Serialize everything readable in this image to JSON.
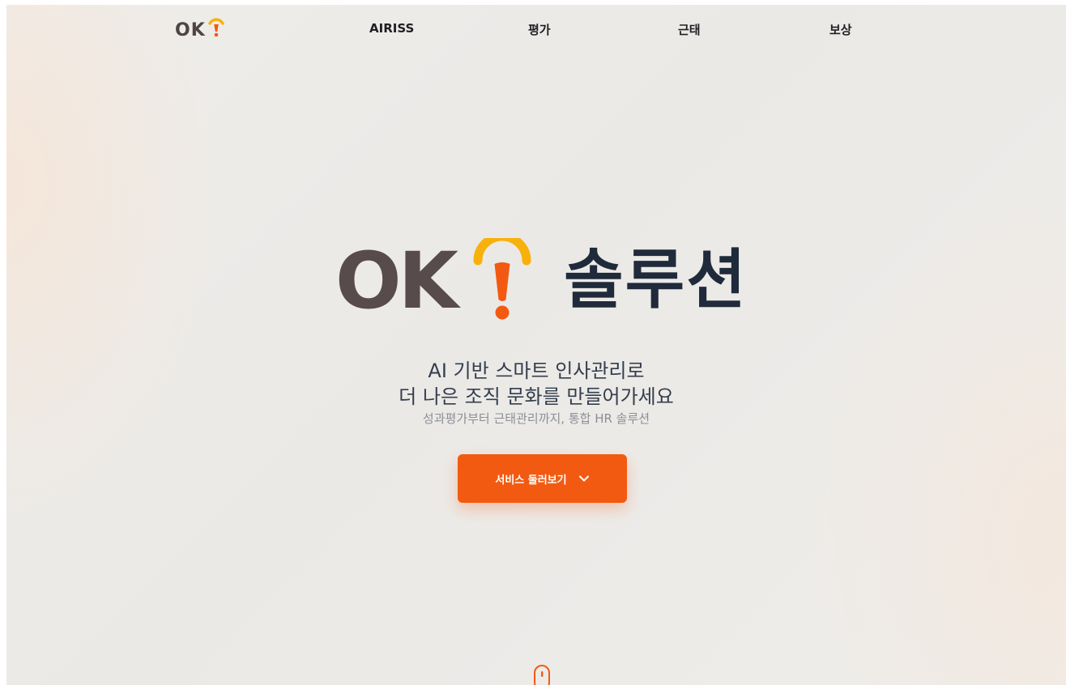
{
  "nav": {
    "logo_text": "OK",
    "items": [
      {
        "label": "AIRISS"
      },
      {
        "label": "평가"
      },
      {
        "label": "근태"
      },
      {
        "label": "보상"
      }
    ]
  },
  "hero": {
    "logo_text": "OK",
    "title": "솔루션",
    "headline_line1": "AI 기반 스마트 인사관리로",
    "headline_line2": "더 나은 조직 문화를 만들어가세요",
    "subline": "성과평가부터 근태관리까지, 통합 HR 솔루션",
    "cta_label": "서비스 둘러보기",
    "cta_icon": "chevron-down-icon",
    "scroll_icon": "mouse-scroll-icon"
  },
  "colors": {
    "brand_orange": "#f35a11",
    "brand_yellow": "#f7b10a",
    "logo_brown": "#574b4b",
    "title_navy": "#1f2a3b",
    "background": "#ecebe8"
  }
}
